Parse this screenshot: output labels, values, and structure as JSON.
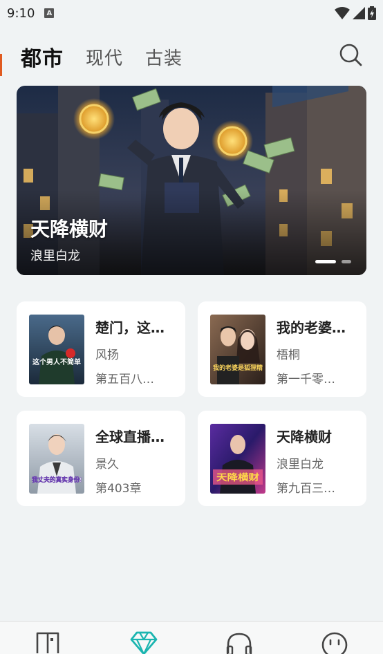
{
  "status": {
    "time": "9:10",
    "notification_letter": "A"
  },
  "tabs": [
    {
      "label": "都市",
      "active": true
    },
    {
      "label": "现代",
      "active": false
    },
    {
      "label": "古装",
      "active": false
    }
  ],
  "banner": {
    "title": "天降横财",
    "author": "浪里白龙",
    "dots": 2,
    "active_dot": 0
  },
  "books": [
    {
      "title": "楚门，这个男人不简单",
      "author": "风扬",
      "chapter": "第五百八十章",
      "cover_text": "这个男人不简单"
    },
    {
      "title": "我的老婆是狐狸精",
      "author": "梧桐",
      "chapter": "第一千零一章",
      "cover_text": "我的老婆是狐狸精"
    },
    {
      "title": "全球直播：我丈夫的真实身份",
      "author": "景久",
      "chapter": "第403章",
      "cover_text": "我丈夫的真实身份!"
    },
    {
      "title": "天降横财",
      "author": "浪里白龙",
      "chapter": "第九百三十章",
      "cover_text": "天降横财"
    }
  ],
  "nav": [
    {
      "icon": "bookshelf-icon"
    },
    {
      "icon": "diamond-icon",
      "active": true
    },
    {
      "icon": "headphones-icon"
    },
    {
      "icon": "profile-face-icon"
    }
  ],
  "colors": {
    "accent": "#1bb5b0",
    "background": "#f0f3f4",
    "card": "#ffffff"
  }
}
